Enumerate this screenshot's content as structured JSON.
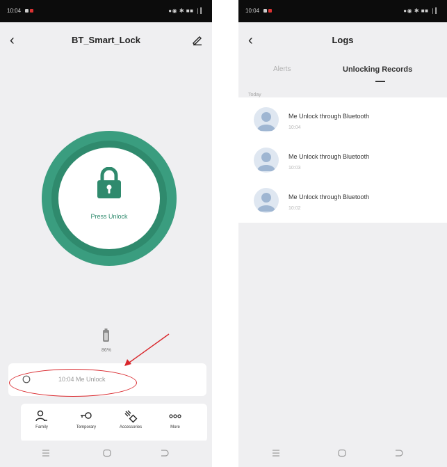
{
  "left_screen": {
    "status_bar": {
      "time": "10:04",
      "right": "●◉ ✱ ■■ ❘▎"
    },
    "title": "BT_Smart_Lock",
    "lock_button": {
      "label": "Press Unlock"
    },
    "battery": {
      "percent": "86%"
    },
    "latest_record": {
      "text": "10:04 Me Unlock"
    },
    "functions": [
      {
        "label": "Family",
        "icon": "family-icon"
      },
      {
        "label": "Temporary",
        "icon": "key-icon"
      },
      {
        "label": "Accessories",
        "icon": "accessories-icon"
      },
      {
        "label": "More",
        "icon": "more-icon"
      }
    ]
  },
  "right_screen": {
    "status_bar": {
      "time": "10:04",
      "right": "●◉ ✱ ■■ ❘▎"
    },
    "title": "Logs",
    "tabs": [
      {
        "label": "Alerts"
      },
      {
        "label": "Unlocking Records"
      }
    ],
    "day_label": "Today",
    "logs": [
      {
        "text": "Me Unlock through Bluetooth",
        "time": "10:04"
      },
      {
        "text": "Me Unlock through Bluetooth",
        "time": "10:03"
      },
      {
        "text": "Me Unlock through Bluetooth",
        "time": "10:02"
      }
    ]
  },
  "colors": {
    "accent": "#2f8a6d",
    "accent_light": "#3a9d7f",
    "annotation": "#d9262b",
    "background": "#efeff1"
  }
}
